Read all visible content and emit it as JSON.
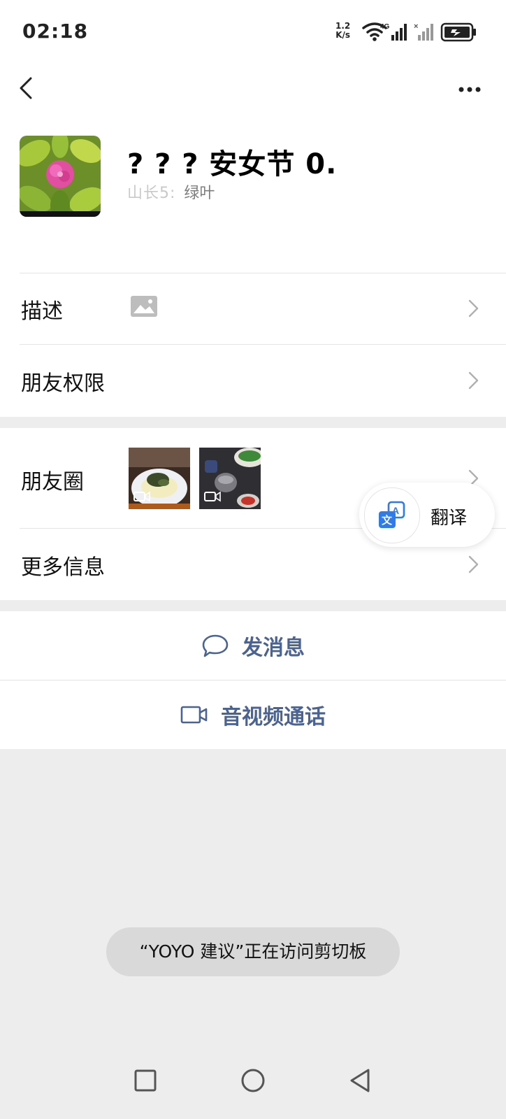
{
  "status_bar": {
    "time": "02:18",
    "net_speed_value": "1.2",
    "net_speed_unit": "K/s",
    "network_type": "4G",
    "icons": [
      "wifi-icon",
      "signal-4g-icon",
      "no-signal-icon",
      "battery-charging-icon"
    ]
  },
  "nav": {
    "back_icon": "chevron-left-icon",
    "more_icon": "more-dots-icon"
  },
  "profile": {
    "nickname": "? ? ? 安女节 0.",
    "id_blurred": "山长5:",
    "id_value": "绿叶"
  },
  "rows": {
    "description": "描述",
    "friend_permissions": "朋友权限",
    "moments": "朋友圈",
    "more_info": "更多信息"
  },
  "translate": {
    "label": "翻译",
    "icon": "translate-icon"
  },
  "actions": {
    "send_message": "发消息",
    "av_call": "音视频通话"
  },
  "toast": {
    "text": "“YOYO 建议”正在访问剪切板"
  },
  "colors": {
    "accent": "#4a6392",
    "background": "#ededed",
    "card": "#ffffff",
    "toast_bg": "#d9d9d9"
  }
}
